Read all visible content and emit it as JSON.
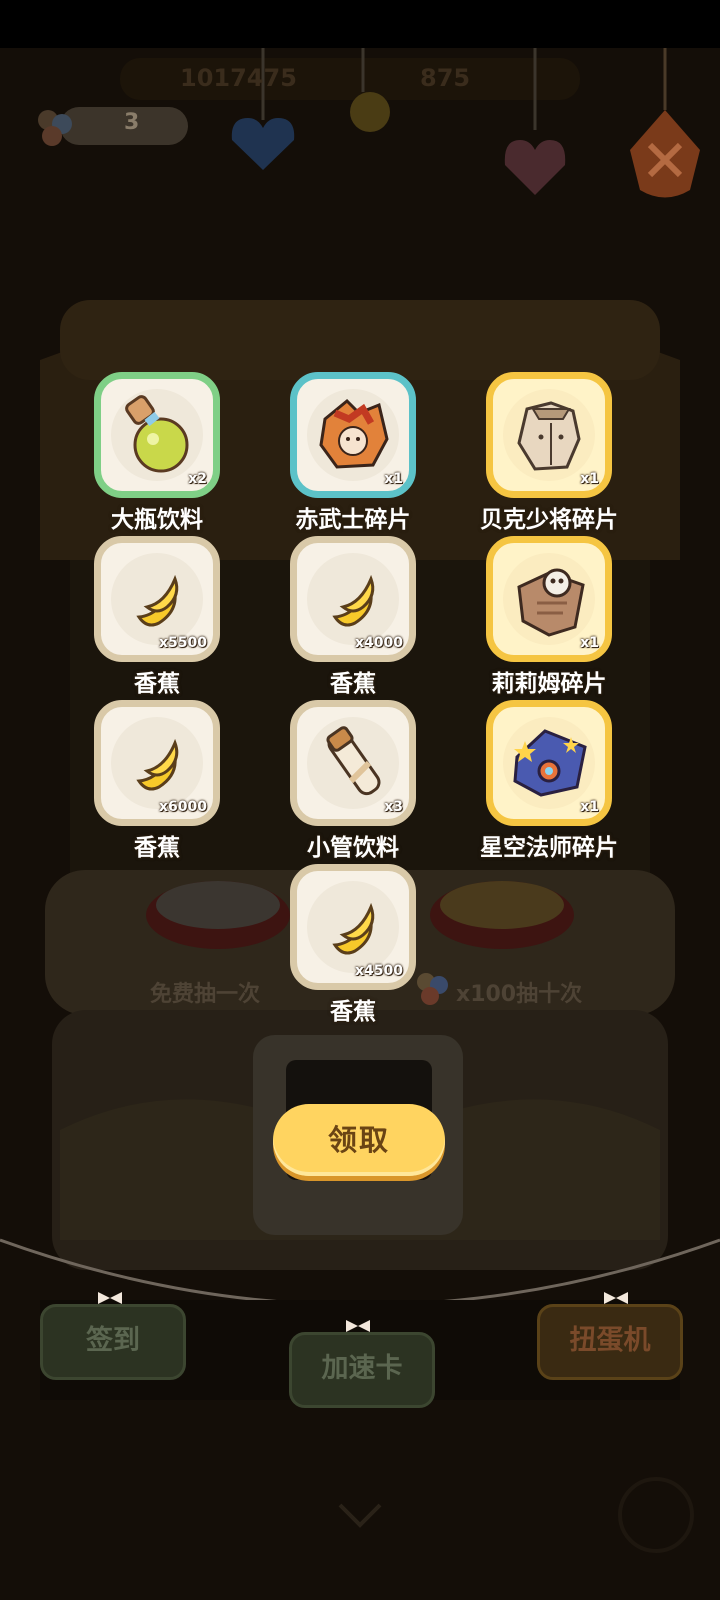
{
  "header": {
    "ticket_count": "3",
    "currency_1": "1017475",
    "currency_2": "875"
  },
  "machine": {
    "free_draw_label": "免费抽一次",
    "ten_draw_label": "x100抽十次"
  },
  "rewards": [
    {
      "name": "大瓶饮料",
      "qty": "x2",
      "rarity": "green",
      "icon": "big-bottle-drink-icon"
    },
    {
      "name": "赤武士碎片",
      "qty": "x1",
      "rarity": "teal",
      "icon": "red-samurai-shard-icon"
    },
    {
      "name": "贝克少将碎片",
      "qty": "x1",
      "rarity": "gold",
      "icon": "major-general-beck-shard-icon"
    },
    {
      "name": "香蕉",
      "qty": "x5500",
      "rarity": "common",
      "icon": "banana-icon"
    },
    {
      "name": "香蕉",
      "qty": "x4000",
      "rarity": "common",
      "icon": "banana-icon"
    },
    {
      "name": "莉莉姆碎片",
      "qty": "x1",
      "rarity": "gold",
      "icon": "lilim-shard-icon"
    },
    {
      "name": "香蕉",
      "qty": "x6000",
      "rarity": "common",
      "icon": "banana-icon"
    },
    {
      "name": "小管饮料",
      "qty": "x3",
      "rarity": "common",
      "icon": "small-tube-drink-icon"
    },
    {
      "name": "星空法师碎片",
      "qty": "x1",
      "rarity": "gold",
      "icon": "starry-mage-shard-icon"
    },
    {
      "name": "香蕉",
      "qty": "x4500",
      "rarity": "common",
      "icon": "banana-icon"
    }
  ],
  "claim_button": "领取",
  "bottom_nav": {
    "checkin": "签到",
    "speedup": "加速卡",
    "gacha": "扭蛋机"
  },
  "colors": {
    "overlay": "#0c0804",
    "claim_button": "#ffd460",
    "common_border": "#d9c9a8",
    "green_border": "#7fcf86",
    "teal_border": "#5cc2c8",
    "gold_border": "#f5c542"
  }
}
